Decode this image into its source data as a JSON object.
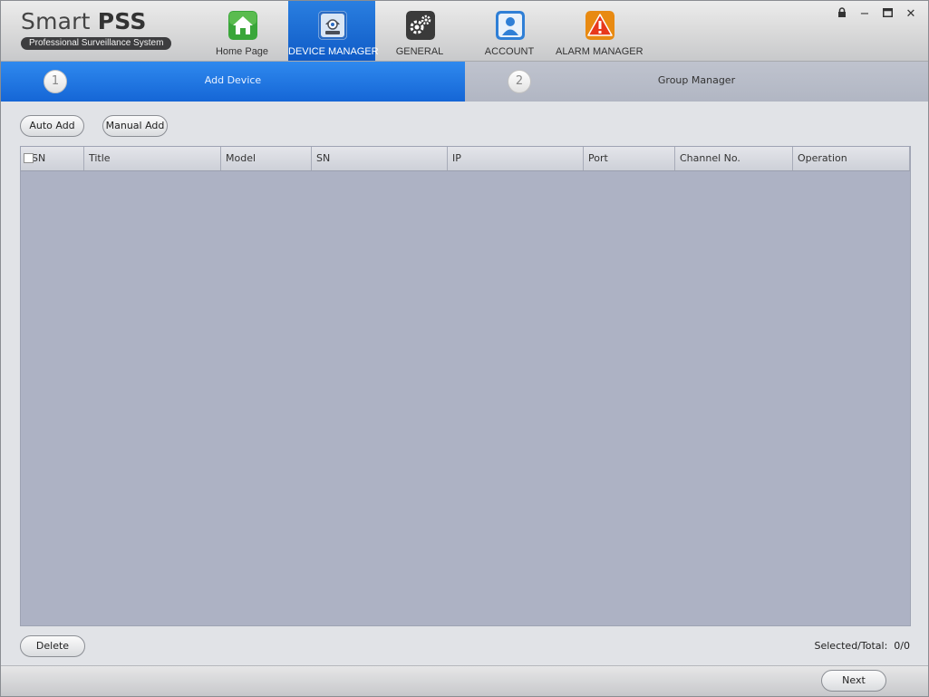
{
  "app": {
    "name_light": "Smart",
    "name_bold": "PSS",
    "subtitle": "Professional Surveillance System"
  },
  "nav": [
    {
      "label": "Home Page",
      "icon": "home-icon"
    },
    {
      "label": "DEVICE MANAGER",
      "icon": "device-manager-icon"
    },
    {
      "label": "GENERAL",
      "icon": "gear-icon"
    },
    {
      "label": "ACCOUNT",
      "icon": "account-icon"
    },
    {
      "label": "ALARM MANAGER",
      "icon": "alarm-icon"
    }
  ],
  "active_nav": "DEVICE MANAGER",
  "window_controls": {
    "lock": "🔒",
    "minimize": "−",
    "maximize": "□",
    "close": "✕"
  },
  "steps": [
    {
      "number": "1",
      "label": "Add Device"
    },
    {
      "number": "2",
      "label": "Group Manager"
    }
  ],
  "toolbar": {
    "auto_add": "Auto Add",
    "manual_add": "Manual Add"
  },
  "table": {
    "columns": [
      "SN",
      "Title",
      "Model",
      "SN",
      "IP",
      "Port",
      "Channel No.",
      "Operation"
    ],
    "rows": []
  },
  "footer": {
    "delete": "Delete",
    "selected_total_label": "Selected/Total:",
    "selected_total_value": "0/0",
    "next": "Next"
  },
  "colors": {
    "accent_blue": "#1566d6",
    "table_bg": "#adb2c4",
    "home_icon": "#3aa63a",
    "device_icon": "#2b6cc4",
    "general_icon": "#3a3a3a",
    "account_icon": "#2f7fd6",
    "alarm_icon": "#e88a12"
  }
}
